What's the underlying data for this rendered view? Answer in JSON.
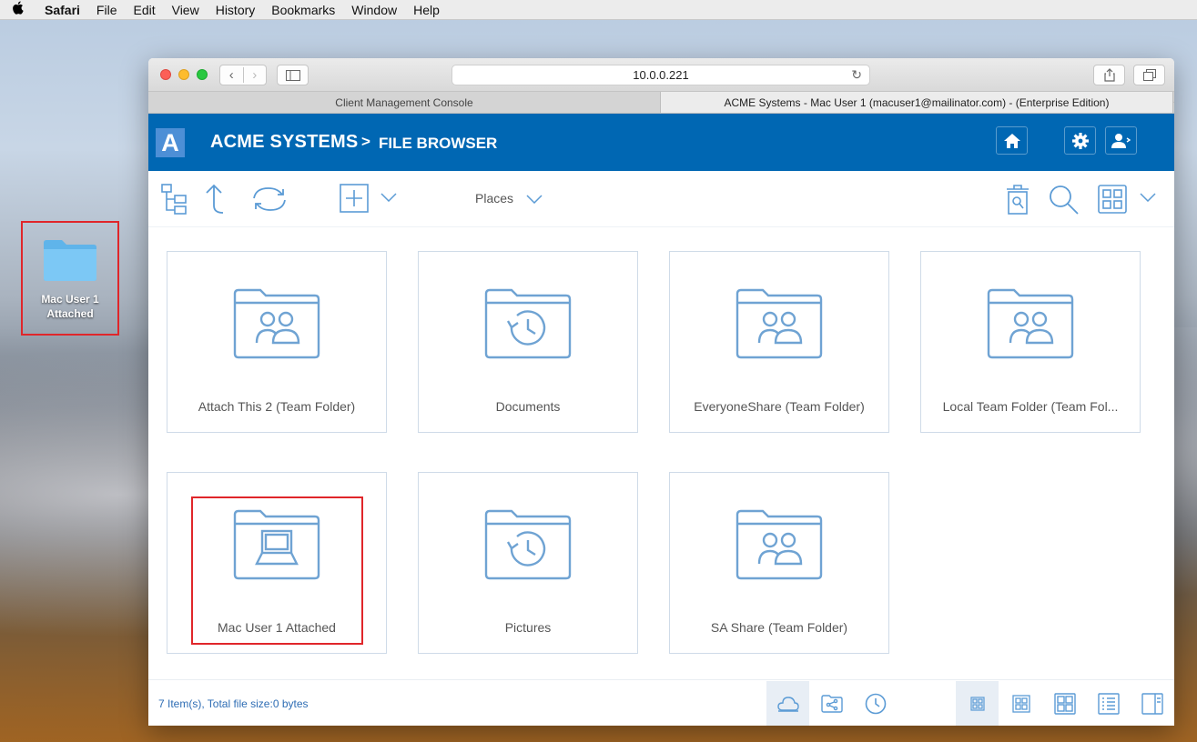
{
  "menubar": {
    "apple": "",
    "app": "Safari",
    "items": [
      "File",
      "Edit",
      "View",
      "History",
      "Bookmarks",
      "Window",
      "Help"
    ]
  },
  "desktop": {
    "icon_label_line1": "Mac User 1",
    "icon_label_line2": "Attached"
  },
  "browser": {
    "address": "10.0.0.221",
    "tabs": [
      "Client Management Console",
      "ACME Systems - Mac User 1 (macuser1@mailinator.com) - (Enterprise Edition)"
    ],
    "new_tab": "+"
  },
  "app": {
    "logo_letter": "A",
    "title": "ACME SYSTEMS",
    "separator": ">",
    "subtitle": "FILE BROWSER"
  },
  "toolbar": {
    "places_label": "Places"
  },
  "folders": [
    {
      "label": "Attach This 2 (Team Folder)",
      "icon": "team-folder-icon"
    },
    {
      "label": "Documents",
      "icon": "history-folder-icon"
    },
    {
      "label": "EveryoneShare (Team Folder)",
      "icon": "team-folder-icon"
    },
    {
      "label": "Local Team Folder (Team Fol...",
      "icon": "team-folder-icon"
    },
    {
      "label": "Mac User 1 Attached",
      "icon": "laptop-folder-icon"
    },
    {
      "label": "Pictures",
      "icon": "history-folder-icon"
    },
    {
      "label": "SA Share (Team Folder)",
      "icon": "team-folder-icon"
    }
  ],
  "footer": {
    "status": "7 Item(s), Total file size:0 bytes"
  },
  "colors": {
    "brand": "#0067b3",
    "icon": "#6fa3d3",
    "highlight": "#e0262a"
  }
}
